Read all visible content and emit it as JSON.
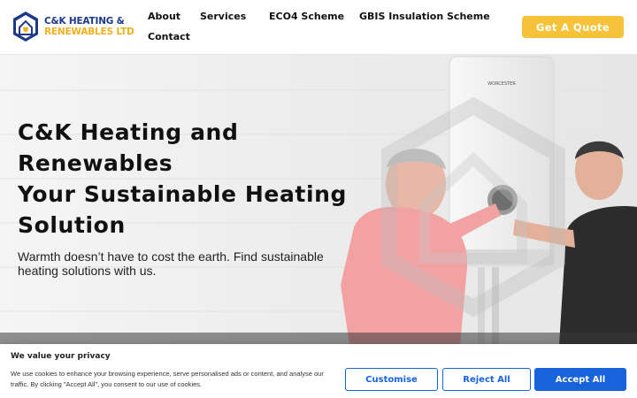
{
  "brand": {
    "line1": "C&K HEATING &",
    "line2": "RENEWABLES LTD",
    "colors": {
      "navy": "#1d3a8a",
      "gold": "#f2b01e"
    }
  },
  "nav": {
    "items": [
      {
        "label": "About"
      },
      {
        "label": "Services"
      },
      {
        "label": "ECO4 Scheme"
      },
      {
        "label": "GBIS Insulation Scheme"
      },
      {
        "label": "Contact"
      }
    ],
    "cta_label": "Get A Quote",
    "cta_color": "#f5c23a"
  },
  "hero": {
    "title_lines": [
      "C&K Heating and",
      "Renewables",
      "Your Sustainable Heating",
      "Solution"
    ],
    "subtitle": "Warmth doesn’t have to cost the earth. Find sustainable heating solutions with us.",
    "boiler_brand": "WORCESTER"
  },
  "cookie_banner": {
    "title": "We value your privacy",
    "text": "We use cookies to enhance your browsing experience, serve personalised ads or content, and analyse our traffic. By clicking \"Accept All\", you consent to our use of cookies.",
    "buttons": {
      "customise": "Customise",
      "reject": "Reject All",
      "accept": "Accept All"
    },
    "accent_color": "#1863dc"
  }
}
